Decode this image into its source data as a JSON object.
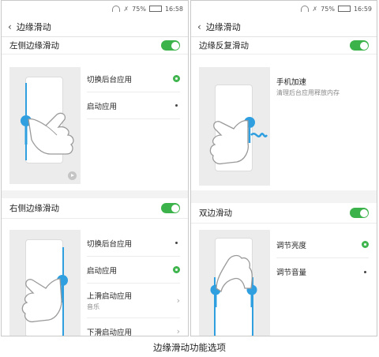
{
  "status": {
    "left": {
      "battery": "75%",
      "time": "16:58"
    },
    "right": {
      "battery": "75%",
      "time": "16:59"
    }
  },
  "left": {
    "title": "边缘滑动",
    "section1": {
      "title": "左侧边缘滑动",
      "toggle_on": true,
      "options": [
        {
          "label": "切换后台应用",
          "state": "selected"
        },
        {
          "label": "启动应用",
          "state": "unselected"
        }
      ]
    },
    "section2": {
      "title": "右侧边缘滑动",
      "toggle_on": true,
      "options": [
        {
          "label": "切换后台应用",
          "state": "unselected"
        },
        {
          "label": "启动应用",
          "state": "selected"
        },
        {
          "label": "上滑启动应用",
          "sub": "音乐",
          "state": "submenu"
        },
        {
          "label": "下滑启动应用",
          "state": "submenu"
        }
      ]
    }
  },
  "right": {
    "title": "边缘滑动",
    "section1": {
      "title": "边缘反复滑动",
      "toggle_on": true,
      "options": [
        {
          "label": "手机加速",
          "sub": "清理后台应用释放内存"
        }
      ]
    },
    "section2": {
      "title": "双边滑动",
      "toggle_on": true,
      "options": [
        {
          "label": "调节亮度",
          "state": "selected"
        },
        {
          "label": "调节音量",
          "state": "unselected"
        }
      ]
    }
  },
  "caption": "边缘滑动功能选项",
  "colors": {
    "accent": "#3bb34a",
    "touch": "#2f9fe0"
  },
  "icons": [
    "wifi-icon",
    "signal-icon",
    "battery-icon",
    "back-arrow-icon",
    "play-icon",
    "hand-gesture-icon",
    "radio-selected-icon",
    "chevron-right-icon"
  ]
}
